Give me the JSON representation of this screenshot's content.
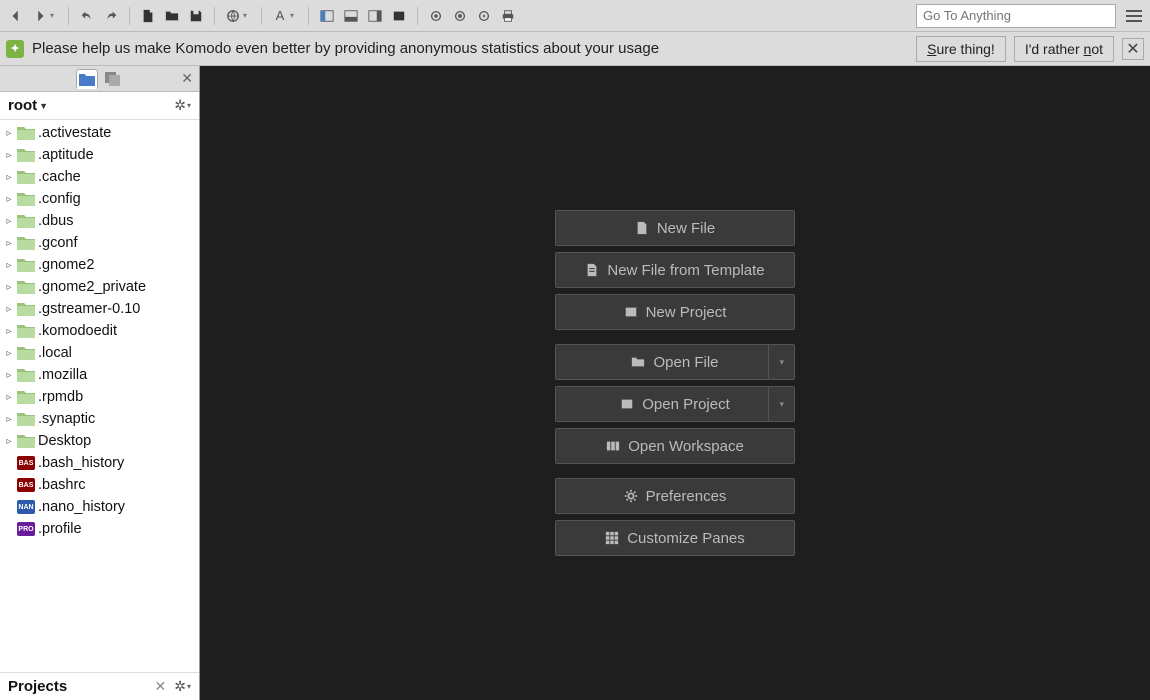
{
  "toolbar": {
    "goto_placeholder": "Go To Anything"
  },
  "notification": {
    "text": "Please help us make Komodo even better by providing anonymous statistics about your usage",
    "accept": "Sure thing!",
    "decline": "I'd rather not"
  },
  "sidebar": {
    "root_label": "root",
    "items": [
      {
        "name": ".activestate",
        "type": "folder"
      },
      {
        "name": ".aptitude",
        "type": "folder"
      },
      {
        "name": ".cache",
        "type": "folder"
      },
      {
        "name": ".config",
        "type": "folder"
      },
      {
        "name": ".dbus",
        "type": "folder"
      },
      {
        "name": ".gconf",
        "type": "folder"
      },
      {
        "name": ".gnome2",
        "type": "folder"
      },
      {
        "name": ".gnome2_private",
        "type": "folder"
      },
      {
        "name": ".gstreamer-0.10",
        "type": "folder"
      },
      {
        "name": ".komodoedit",
        "type": "folder"
      },
      {
        "name": ".local",
        "type": "folder"
      },
      {
        "name": ".mozilla",
        "type": "folder"
      },
      {
        "name": ".rpmdb",
        "type": "folder"
      },
      {
        "name": ".synaptic",
        "type": "folder"
      },
      {
        "name": "Desktop",
        "type": "folder"
      },
      {
        "name": ".bash_history",
        "type": "file",
        "badge": "BAS"
      },
      {
        "name": ".bashrc",
        "type": "file",
        "badge": "BAS"
      },
      {
        "name": ".nano_history",
        "type": "file",
        "badge": "NAN"
      },
      {
        "name": ".profile",
        "type": "file",
        "badge": "PRO"
      }
    ],
    "footer_label": "Projects"
  },
  "start": {
    "new_file": "New File",
    "new_template": "New File from Template",
    "new_project": "New Project",
    "open_file": "Open File",
    "open_project": "Open Project",
    "open_workspace": "Open Workspace",
    "preferences": "Preferences",
    "customize_panes": "Customize Panes"
  }
}
